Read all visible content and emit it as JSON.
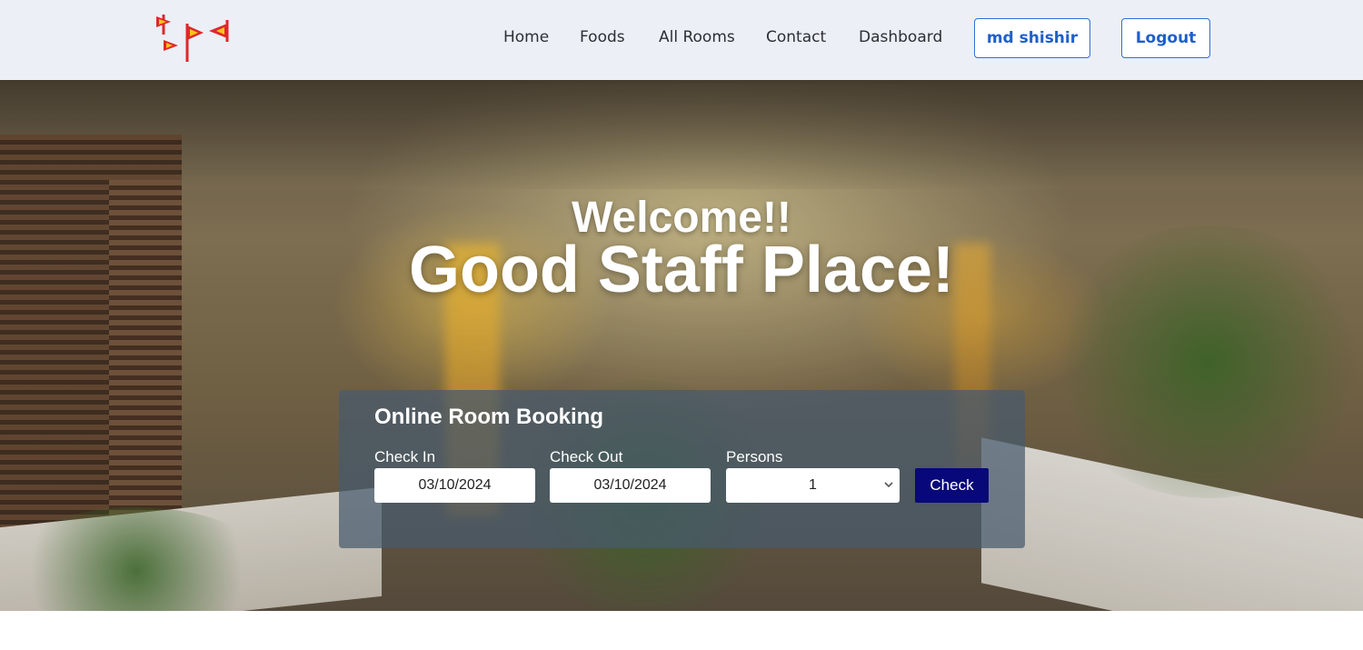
{
  "nav": {
    "links": [
      "Home",
      "Foods",
      "All Rooms",
      "Contact",
      "Dashboard"
    ],
    "user_button": "md shishir",
    "logout_button": "Logout"
  },
  "hero": {
    "welcome": "Welcome!!",
    "tagline": "Good Staff Place!"
  },
  "booking": {
    "title": "Online Room Booking",
    "check_in_label": "Check In",
    "check_in_value": "03/10/2024",
    "check_out_label": "Check Out",
    "check_out_value": "03/10/2024",
    "persons_label": "Persons",
    "persons_value": "1",
    "check_button": "Check"
  },
  "colors": {
    "navbar_bg": "#eceff5",
    "nav_button_border": "#2f6fd6",
    "check_button_bg": "#08087a",
    "logo_red": "#e0262b",
    "logo_yellow": "#f5c518"
  },
  "icons": {
    "logo": "flags-logo",
    "select": "chevron-down-icon"
  }
}
